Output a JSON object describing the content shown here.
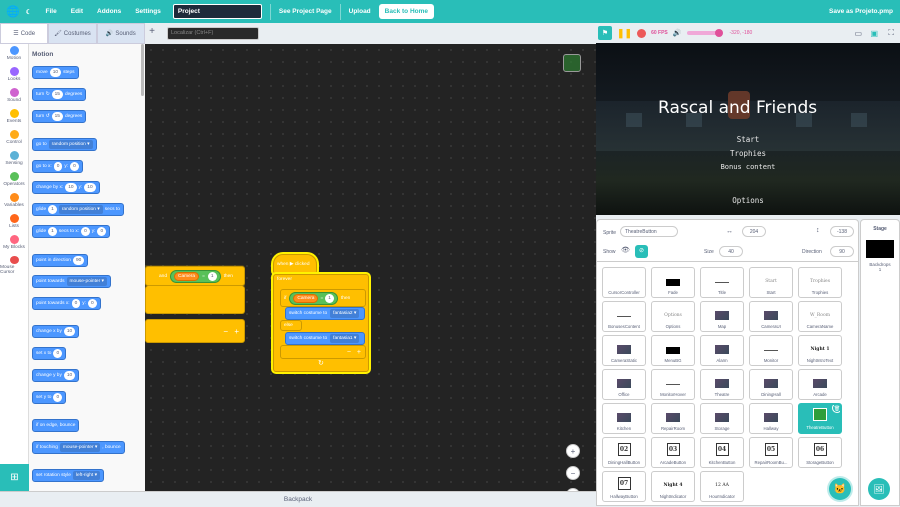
{
  "menubar": {
    "logo_icon": "🌐",
    "moon_icon": "☾",
    "file": "File",
    "edit": "Edit",
    "addons": "Addons",
    "settings": "Settings",
    "project_title": "Project",
    "see_project": "See Project Page",
    "upload": "Upload",
    "back_home": "Back to Home",
    "save_as": "Save as Projeto.pmp"
  },
  "tabs": {
    "code": "Code",
    "costumes": "Costumes",
    "sounds": "Sounds"
  },
  "search_placeholder": "Localizar (Ctrl+F)",
  "categories": [
    {
      "label": "Motion",
      "color": "#4c97ff"
    },
    {
      "label": "Looks",
      "color": "#9966ff"
    },
    {
      "label": "Sound",
      "color": "#cf63cf"
    },
    {
      "label": "Events",
      "color": "#ffbf00"
    },
    {
      "label": "Control",
      "color": "#ffab19"
    },
    {
      "label": "Sensing",
      "color": "#5cb1d6"
    },
    {
      "label": "Operators",
      "color": "#59c059"
    },
    {
      "label": "Variables",
      "color": "#ff8c1a"
    },
    {
      "label": "Lists",
      "color": "#ff661a"
    },
    {
      "label": "My Blocks",
      "color": "#ff6680"
    },
    {
      "label": "Mouse Cursor",
      "color": "#e84d4d"
    }
  ],
  "palette": {
    "title": "Motion",
    "blocks": [
      {
        "t1": "move",
        "v1": "10",
        "t2": "steps"
      },
      {
        "t1": "turn ↻",
        "v1": "15",
        "t2": "degrees"
      },
      {
        "t1": "turn ↺",
        "v1": "15",
        "t2": "degrees"
      },
      {
        "t1": "go to",
        "d1": "random position ▾"
      },
      {
        "t1": "go to x:",
        "v1": "0",
        "t2": "y:",
        "v2": "0"
      },
      {
        "t1": "change by x:",
        "v1": "10",
        "t2": "y:",
        "v2": "10"
      },
      {
        "t1": "glide",
        "v1": "1",
        "t2": "secs to",
        "d1": "random position ▾"
      },
      {
        "t1": "glide",
        "v1": "1",
        "t2": "secs to x:",
        "v2": "0",
        "t3": "y:",
        "v3": "0"
      },
      {
        "t1": "point in direction",
        "v1": "90"
      },
      {
        "t1": "point towards",
        "d1": "mouse-pointer ▾"
      },
      {
        "t1": "point towards x:",
        "v1": "0",
        "t2": "y:",
        "v2": "0"
      },
      {
        "t1": "change x by",
        "v1": "10"
      },
      {
        "t1": "set x to",
        "v1": "0"
      },
      {
        "t1": "change y by",
        "v1": "10"
      },
      {
        "t1": "set y to",
        "v1": "0"
      },
      {
        "t1": "if on edge, bounce"
      },
      {
        "t1": "if touching",
        "d1": "mouse-pointer ▾",
        "t2": ", bounce"
      },
      {
        "t1": "set rotation style",
        "d1": "left-right ▾"
      }
    ]
  },
  "workspace": {
    "and_label": "and",
    "camera_var": "Camera",
    "eq": "=",
    "one": "1",
    "then": "then",
    "when_clicked": "when ▶ clicked",
    "forever": "forever",
    "if": "if",
    "else": "else",
    "switch1": "switch costume to",
    "costume1": "fantasia2 ▾",
    "switch2": "switch costume to",
    "costume2": "fantasia1 ▾",
    "minus": "−",
    "plus": "+"
  },
  "zoom": {
    "in": "+",
    "out": "−",
    "reset": "="
  },
  "backpack": "Backpack",
  "stage_toolbar": {
    "fps": "60 FPS",
    "coords": "-320, -180"
  },
  "stage": {
    "title": "Rascal and Friends",
    "options": [
      "Start",
      "Trophies",
      "Bonus content",
      "Options"
    ]
  },
  "sprite_info": {
    "sprite_label": "Sprite",
    "sprite_name": "TheatreButton",
    "x_label": "↔",
    "x": "204",
    "y_label": "↕",
    "y": "-138",
    "show_label": "Show",
    "size_label": "Size",
    "size": "40",
    "direction_label": "Direction",
    "direction": "90"
  },
  "stage_panel": {
    "label": "Stage",
    "backdrops_label": "Backdrops",
    "backdrops_count": "1"
  },
  "sprites": [
    {
      "name": "CursorController",
      "thumb": ""
    },
    {
      "name": "Fade",
      "thumb": "blk"
    },
    {
      "name": "Title",
      "thumb": "line"
    },
    {
      "name": "Start",
      "thumb": "Start"
    },
    {
      "name": "Trophies",
      "thumb": "Trophies"
    },
    {
      "name": "BonusesContent",
      "thumb": "line"
    },
    {
      "name": "Options",
      "thumb": "Options"
    },
    {
      "name": "Map",
      "thumb": "img"
    },
    {
      "name": "CameraUI",
      "thumb": "img"
    },
    {
      "name": "CameraName",
      "thumb": "W_Room"
    },
    {
      "name": "CameraStatic",
      "thumb": "img"
    },
    {
      "name": "MenuBG",
      "thumb": "blk"
    },
    {
      "name": "Alarm",
      "thumb": "img"
    },
    {
      "name": "Monitor",
      "thumb": "line"
    },
    {
      "name": "NightIntroText",
      "thumb": "Night 1"
    },
    {
      "name": "Office",
      "thumb": "img"
    },
    {
      "name": "MonitorHover",
      "thumb": "line"
    },
    {
      "name": "Theatre",
      "thumb": "img"
    },
    {
      "name": "DiningHall",
      "thumb": "img"
    },
    {
      "name": "Arcade",
      "thumb": "img"
    },
    {
      "name": "Kitchen",
      "thumb": "img"
    },
    {
      "name": "RepairRoom",
      "thumb": "img"
    },
    {
      "name": "Storage",
      "thumb": "img"
    },
    {
      "name": "Hallway",
      "thumb": "img"
    },
    {
      "name": "TheatreButton",
      "thumb": "sel"
    },
    {
      "name": "DiningHallButton",
      "thumb": "02"
    },
    {
      "name": "ArcadeButton",
      "thumb": "03"
    },
    {
      "name": "KitchenButton",
      "thumb": "04"
    },
    {
      "name": "RepairRoomBu...",
      "thumb": "05"
    },
    {
      "name": "StorageButton",
      "thumb": "06"
    },
    {
      "name": "HallwayButton",
      "thumb": "07"
    },
    {
      "name": "NightIndicator",
      "thumb": "Night 4"
    },
    {
      "name": "HourIndicator",
      "thumb": "12 AA"
    }
  ]
}
